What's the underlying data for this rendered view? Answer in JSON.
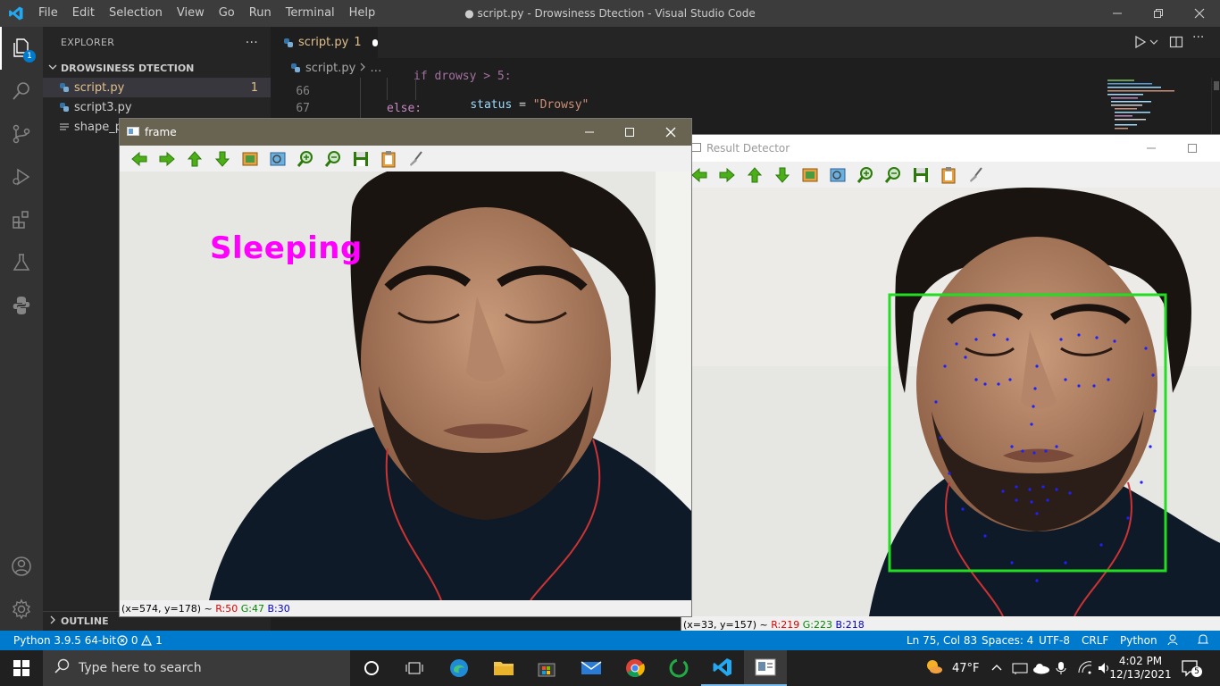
{
  "window": {
    "title": "● script.py - Drowsiness Dtection - Visual Studio Code",
    "menu": [
      "File",
      "Edit",
      "Selection",
      "View",
      "Go",
      "Run",
      "Terminal",
      "Help"
    ]
  },
  "activity": {
    "explorer_badge": "1"
  },
  "sidebar": {
    "header": "EXPLORER",
    "more": "···",
    "folder": "DROWSINESS DTECTION",
    "files": [
      {
        "name": "script.py",
        "problems": "1"
      },
      {
        "name": "script3.py"
      },
      {
        "name": "shape_pr"
      }
    ],
    "outline": "OUTLINE"
  },
  "editor": {
    "tab_label": "script.py",
    "tab_problems": "1",
    "breadcrumb_file": "script.py",
    "breadcrumb_more": "…",
    "lines": [
      {
        "num": "66",
        "code": "status = \"Drowsy\"",
        "keyword": "status",
        "str": "\"Drowsy\""
      },
      {
        "num": "67",
        "code": "else:"
      }
    ],
    "partial_line": "if drowsy > 5:"
  },
  "frame_window": {
    "title": "frame",
    "overlay_text": "Sleeping",
    "status_prefix": "(x=574, y=178) ~ ",
    "r": "R:50",
    "g": "G:47",
    "b": "B:30"
  },
  "result_window": {
    "title": "Result Detector",
    "status_prefix": "(x=33, y=157) ~ ",
    "r": "R:219",
    "g": "G:223",
    "b": "B:218"
  },
  "statusbar": {
    "python": "Python 3.9.5 64-bit",
    "errors": "0",
    "warnings": "1",
    "position": "Ln 75, Col 83",
    "spaces": "Spaces: 4",
    "encoding": "UTF-8",
    "eol": "CRLF",
    "language": "Python"
  },
  "taskbar": {
    "search_placeholder": "Type here to search",
    "weather": "47°F",
    "time": "4:02 PM",
    "date": "12/13/2021",
    "notifications": "5"
  },
  "colors": {
    "accent": "#007acc",
    "overlay_magenta": "#ff00ff",
    "face_box": "#22dd22",
    "landmark": "#2020ff"
  }
}
